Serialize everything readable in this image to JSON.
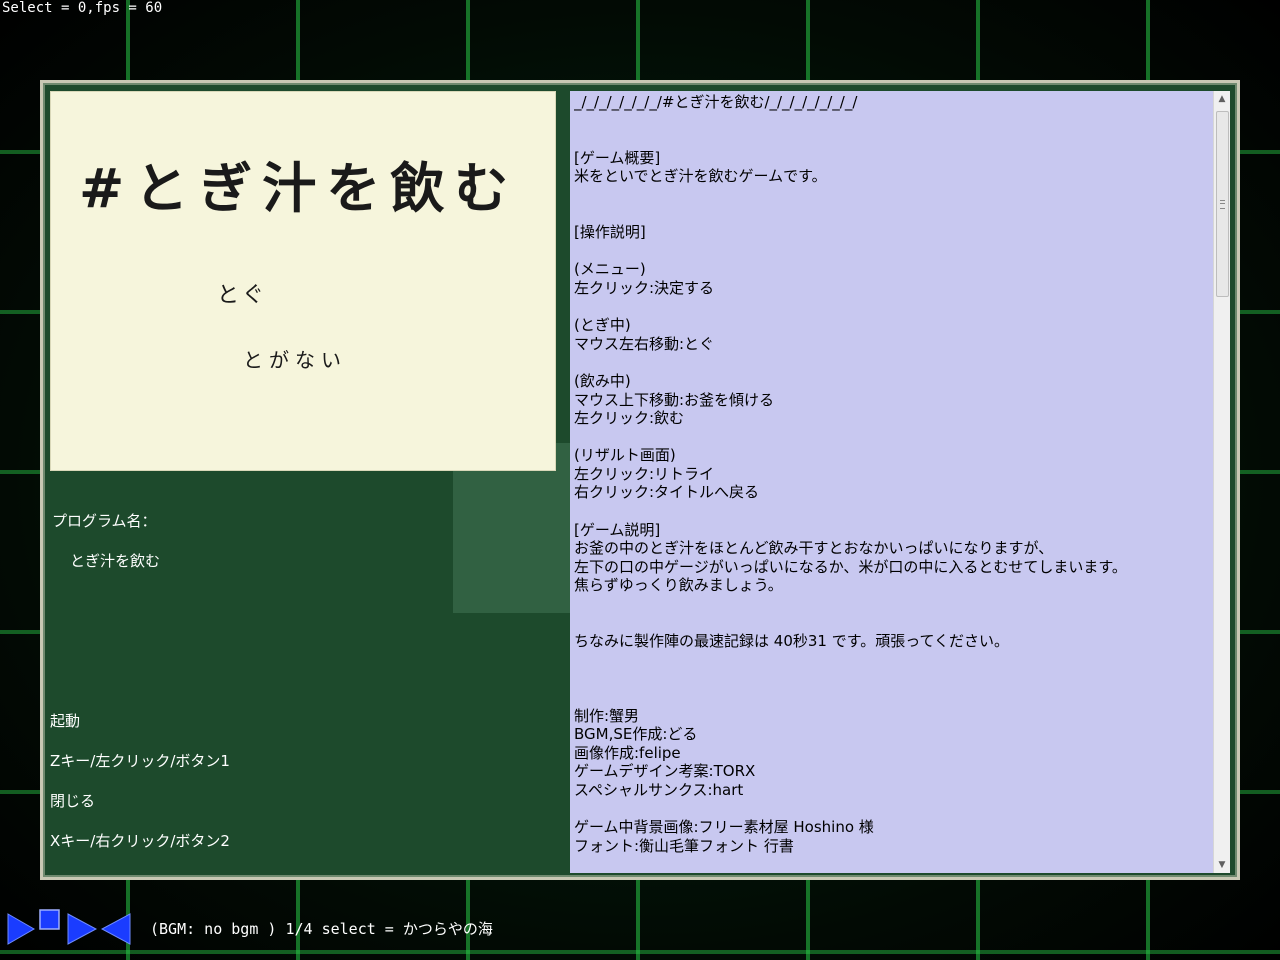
{
  "debug": {
    "status": "Select = 0,fps = 60"
  },
  "title_image": {
    "heading": "#とぎ汁を飲む",
    "option_1": "とぐ",
    "option_2": "とがない"
  },
  "left": {
    "program_label": "プログラム名：",
    "program_name": "とぎ汁を飲む",
    "launch_label": "起動",
    "launch_keys": "Zキー/左クリック/ボタン1",
    "close_label": "閉じる",
    "close_keys": "Xキー/右クリック/ボタン2"
  },
  "readme": {
    "text": "_/_/_/_/_/_/_/#とぎ汁を飲む/_/_/_/_/_/_/_/\n\n\n[ゲーム概要]\n米をといでとぎ汁を飲むゲームです。\n\n\n[操作説明]\n\n(メニュー)\n左クリック:決定する\n\n(とぎ中)\nマウス左右移動:とぐ\n\n(飲み中)\nマウス上下移動:お釜を傾ける\n左クリック:飲む\n\n(リザルト画面)\n左クリック:リトライ\n右クリック:タイトルへ戻る\n\n[ゲーム説明]\nお釜の中のとぎ汁をほとんど飲み干すとおなかいっぱいになりますが、\n左下の口の中ゲージがいっぱいになるか、米が口の中に入るとむせてしまいます。\n焦らずゆっくり飲みましょう。\n\n\nちなみに製作陣の最速記録は 40秒31 です。頑張ってください。\n\n\n\n制作:蟹男\nBGM,SE作成:どる\n画像作成:felipe\nゲームデザイン考案:TORX\nスペシャルサンクス:hart\n\nゲーム中背景画像:フリー素材屋 Hoshino 様\nフォント:衡山毛筆フォント 行書"
  },
  "bgm": {
    "status": "(BGM: no bgm ) 1/4 select = かつらやの海"
  },
  "colors": {
    "window_bg": "#1d4a2c",
    "panel_bg": "#c8c8f0",
    "title_bg": "#f6f5dc",
    "player_blue": "#1a3cff",
    "grid_green": "#28c846"
  }
}
